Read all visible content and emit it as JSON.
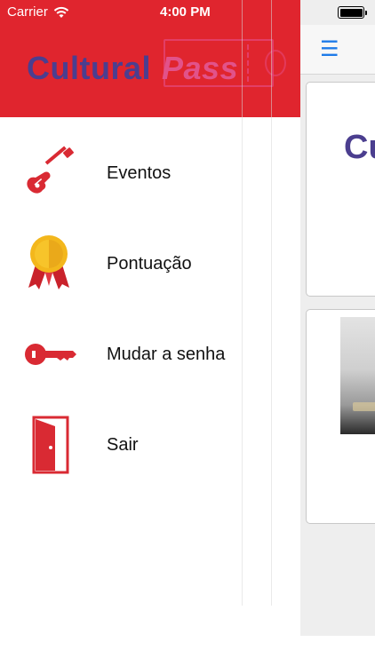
{
  "status_bar": {
    "carrier": "Carrier",
    "time": "4:00 PM"
  },
  "drawer": {
    "brand": {
      "cultural": "Cultural",
      "pass": "Pass"
    },
    "menu": [
      {
        "label": "Eventos",
        "icon": "guitar-icon"
      },
      {
        "label": "Pontuação",
        "icon": "medal-icon"
      },
      {
        "label": "Mudar a senha",
        "icon": "key-icon"
      },
      {
        "label": "Sair",
        "icon": "door-exit-icon"
      }
    ]
  },
  "main": {
    "menu_glyph": "☰",
    "card_logo_text": "Cu"
  },
  "colors": {
    "header_red": "#e0252e",
    "icon_red": "#d92a33",
    "brand_purple": "#4b3e8f",
    "brand_pink": "#e2528a",
    "link_blue": "#1e7be8"
  }
}
